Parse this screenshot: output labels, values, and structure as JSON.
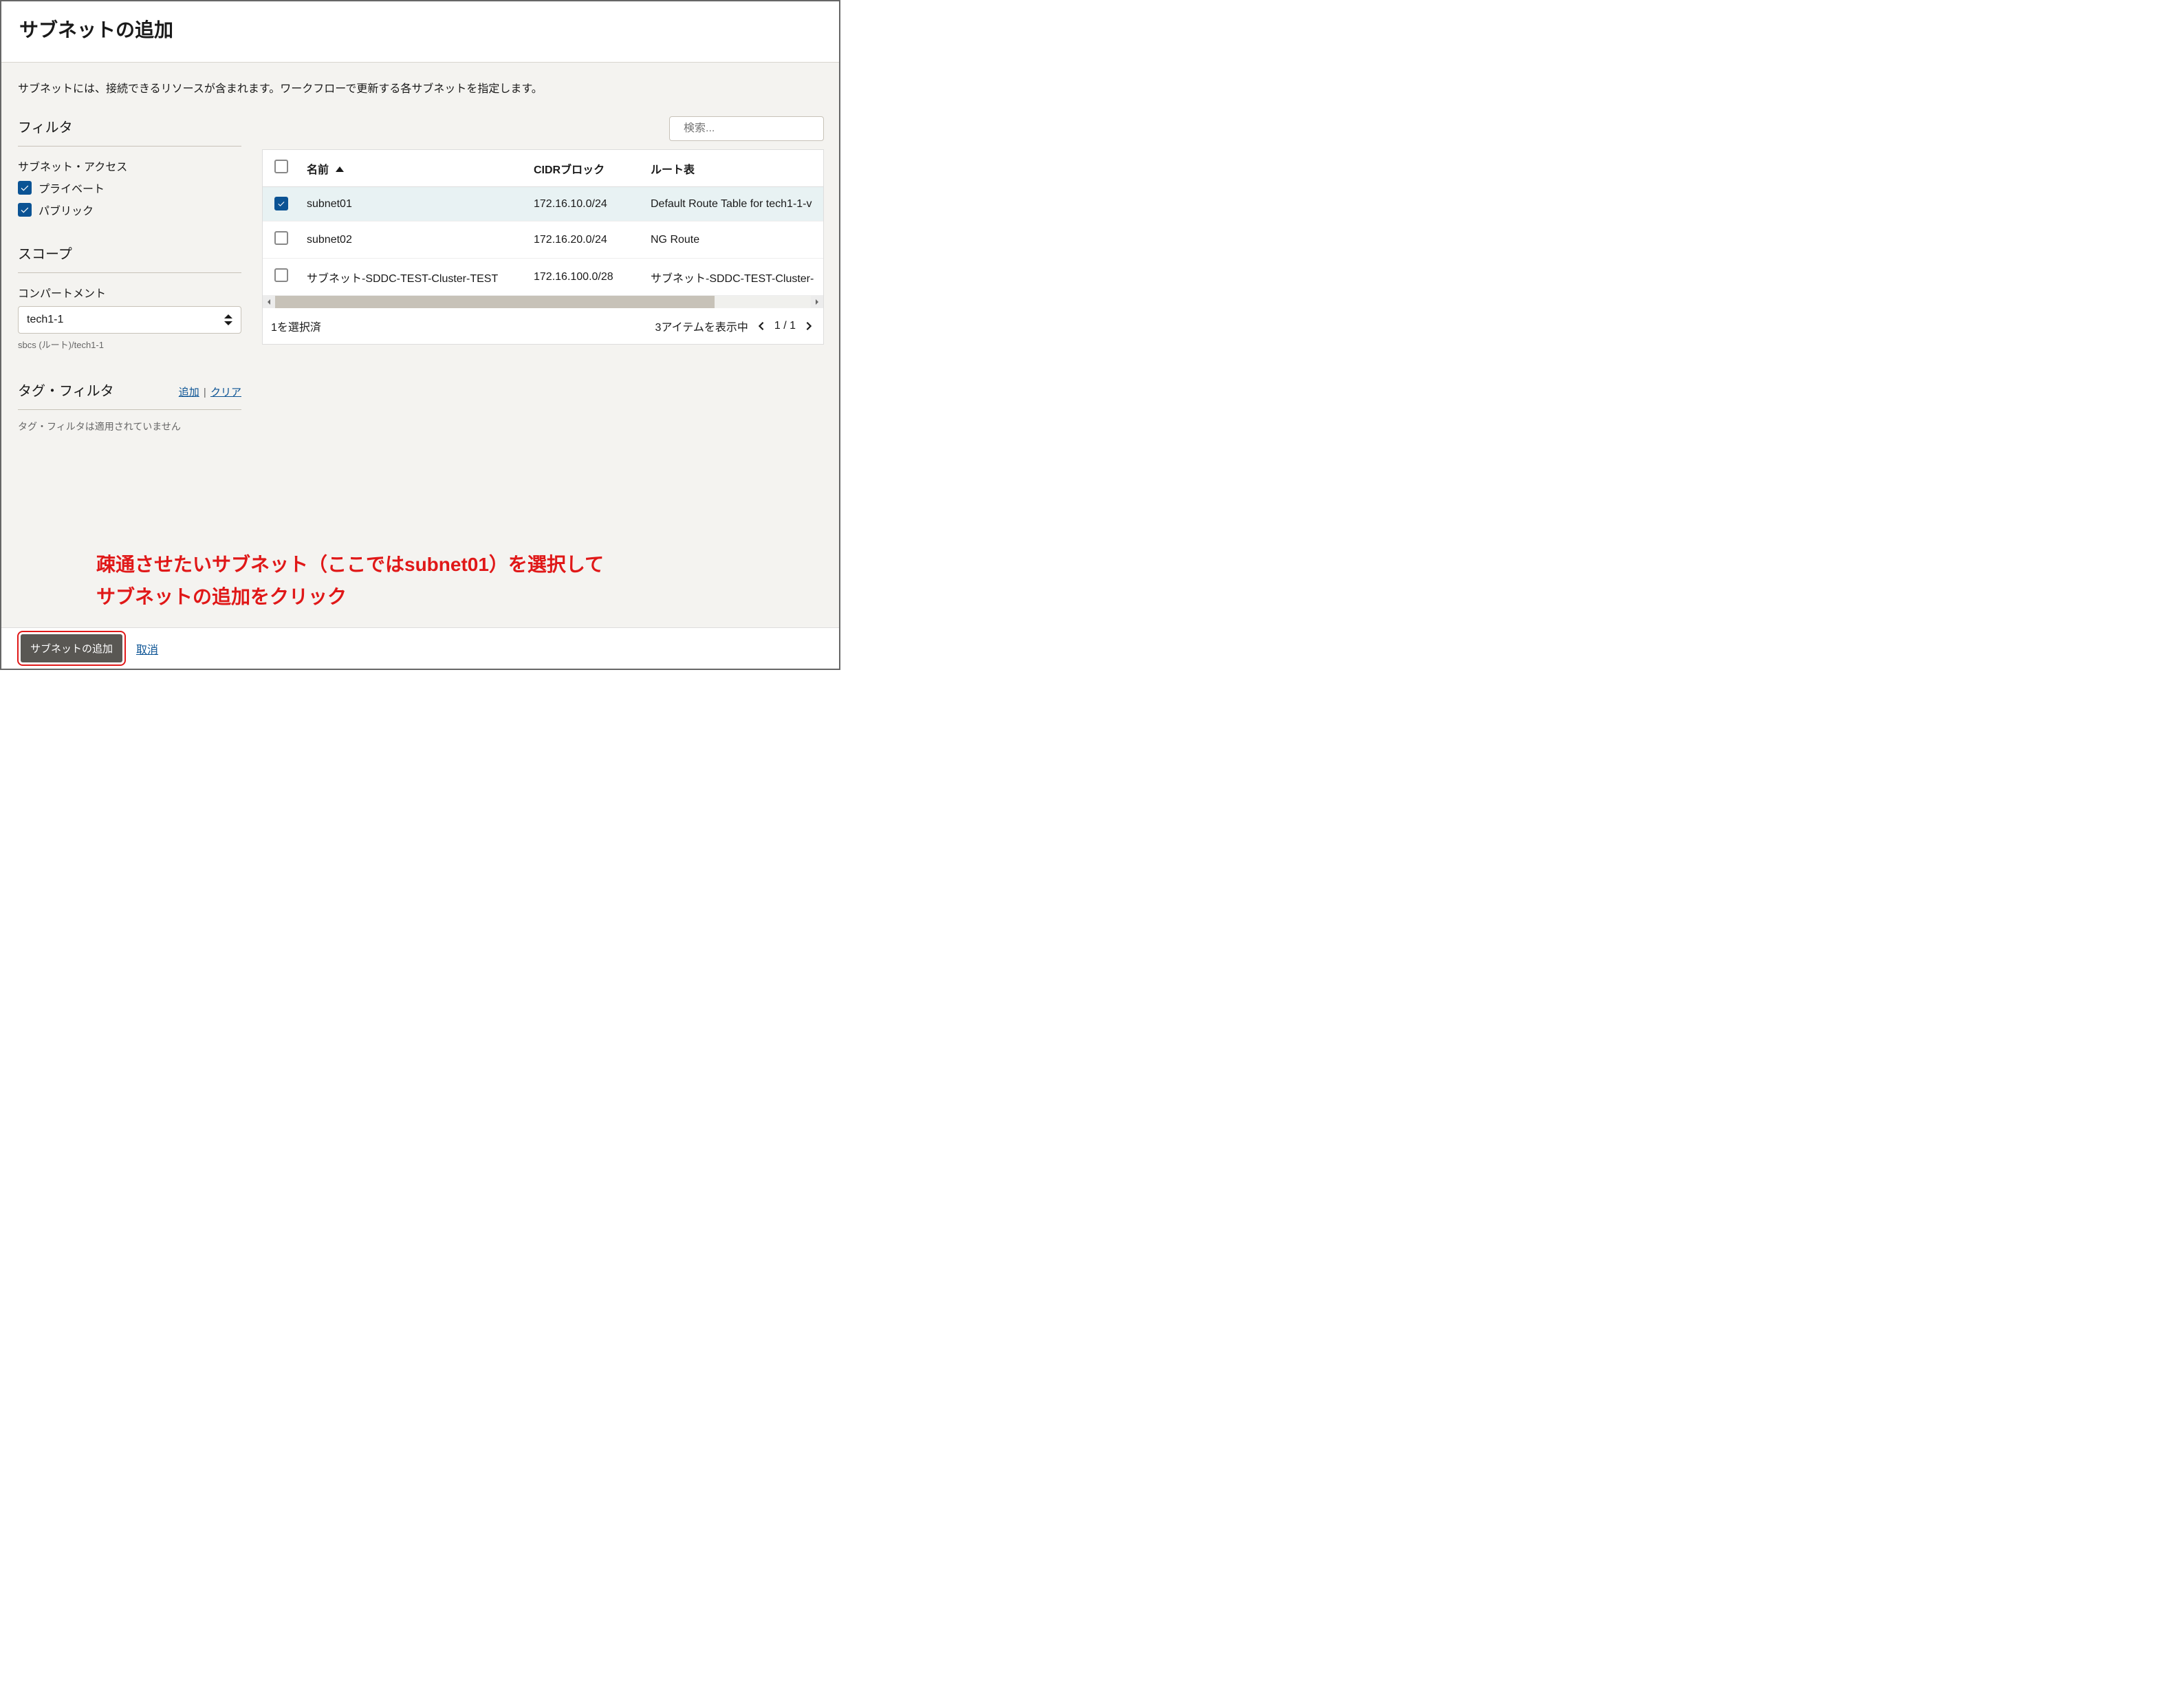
{
  "header": {
    "title": "サブネットの追加"
  },
  "description": "サブネットには、接続できるリソースが含まれます。ワークフローで更新する各サブネットを指定します。",
  "sidebar": {
    "filter_title": "フィルタ",
    "subnet_access_label": "サブネット・アクセス",
    "private_label": "プライベート",
    "public_label": "パブリック",
    "scope_title": "スコープ",
    "compartment_label": "コンパートメント",
    "compartment_value": "tech1-1",
    "compartment_path": "sbcs (ルート)/tech1-1",
    "tag_filter_title": "タグ・フィルタ",
    "tag_add": "追加",
    "tag_clear": "クリア",
    "tag_empty": "タグ・フィルタは適用されていません"
  },
  "search": {
    "placeholder": "検索..."
  },
  "table": {
    "columns": {
      "name": "名前",
      "cidr": "CIDRブロック",
      "route": "ルート表"
    },
    "rows": [
      {
        "name": "subnet01",
        "cidr": "172.16.10.0/24",
        "route": "Default Route Table for tech1-1-v",
        "checked": true
      },
      {
        "name": "subnet02",
        "cidr": "172.16.20.0/24",
        "route": "NG Route",
        "checked": false
      },
      {
        "name": "サブネット-SDDC-TEST-Cluster-TEST",
        "cidr": "172.16.100.0/28",
        "route": "サブネット-SDDC-TEST-Cluster-",
        "checked": false
      }
    ],
    "selected_text": "1を選択済",
    "item_count_text": "3アイテムを表示中",
    "page_text": "1 / 1"
  },
  "annotation": {
    "line1": "疎通させたいサブネット（ここではsubnet01）を選択して",
    "line2": "サブネットの追加をクリック"
  },
  "footer": {
    "primary": "サブネットの追加",
    "cancel": "取消"
  }
}
